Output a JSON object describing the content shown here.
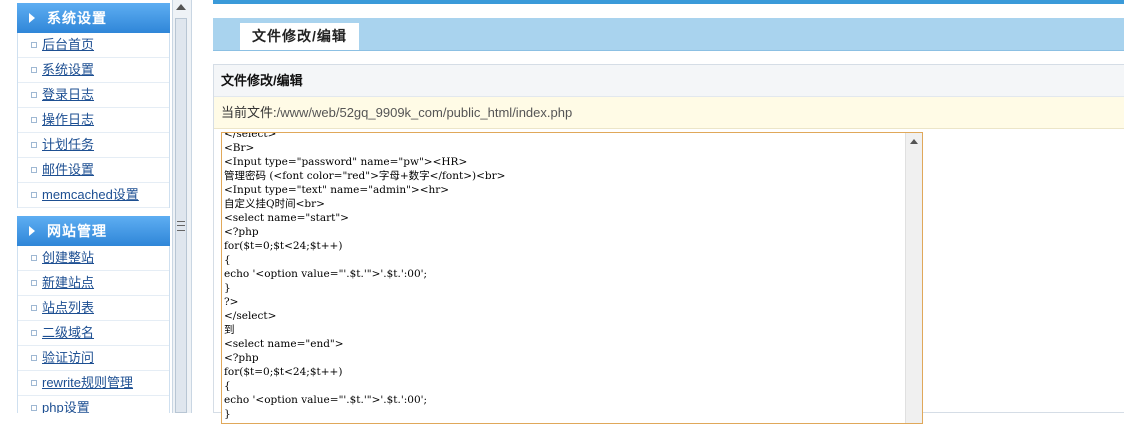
{
  "sidebar": {
    "sections": [
      {
        "title": "系统设置",
        "items": [
          "后台首页",
          "系统设置",
          "登录日志",
          "操作日志",
          "计划任务",
          "邮件设置",
          "memcached设置"
        ]
      },
      {
        "title": "网站管理",
        "items": [
          "创建整站",
          "新建站点",
          "站点列表",
          "二级域名",
          "验证访问",
          "rewrite规则管理",
          "php设置"
        ]
      }
    ]
  },
  "main": {
    "tab_label": "文件修改/编辑",
    "panel_title": "文件修改/编辑",
    "current_file_label": "当前文件:",
    "current_file_path": "/www/web/52gq_9909k_com/public_html/index.php",
    "code_lines": [
      "</select>",
      "<Br>",
      "<Input type=\"password\" name=\"pw\"><HR>",
      "管理密码 (<font color=\"red\">字母+数字</font>)<br>",
      "<Input type=\"text\" name=\"admin\"><hr>",
      "自定义挂Q时间<br>",
      "<select name=\"start\">",
      "<?php",
      "for($t=0;$t<24;$t++)",
      "{",
      "echo '<option value=\"'.$t.'\">'.$t.':00';",
      "}",
      "?>",
      "</select>",
      "到",
      "<select name=\"end\">",
      "<?php",
      "for($t=0;$t<24;$t++)",
      "{",
      "echo '<option value=\"'.$t.'\">'.$t.':00';",
      "}"
    ]
  },
  "colors": {
    "sidebar_header": "#3a8fdd",
    "tab_bar": "#a9d3ee",
    "file_bar": "#fffbe6",
    "editor_border": "#e0a85a",
    "link": "#1d4f92"
  }
}
